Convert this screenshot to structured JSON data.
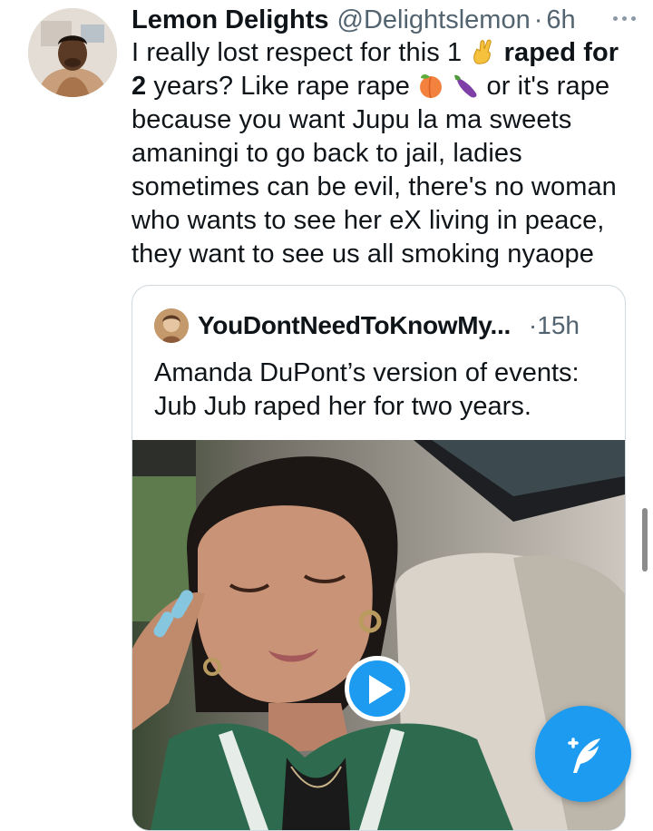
{
  "tweet": {
    "author_name": "Lemon Delights",
    "author_handle": "@Delightslemon",
    "separator": "·",
    "time": "6h",
    "text_1": "I really lost respect for this 1",
    "text_bold_1": "raped for",
    "text_bold_2": "2",
    "text_2": "years? Like rape rape",
    "text_3": "or it's rape because you want Jupu la ma sweets amaningi to go back to jail, ladies sometimes can be evil, there's no woman who wants to see her eX living in peace, they want to see us all smoking nyaope",
    "emojis": [
      "crossed-fingers-emoji",
      "peach-emoji",
      "eggplant-emoji"
    ]
  },
  "quoted_tweet": {
    "author_name": "YouDontNeedToKnowMy...",
    "time": "·15h",
    "text": "Amanda DuPont’s version of events: Jub Jub raped her for two years."
  },
  "colors": {
    "accent": "#1d9bf0",
    "text_primary": "#0f1419",
    "text_secondary": "#536471",
    "border": "#cfd9de"
  }
}
